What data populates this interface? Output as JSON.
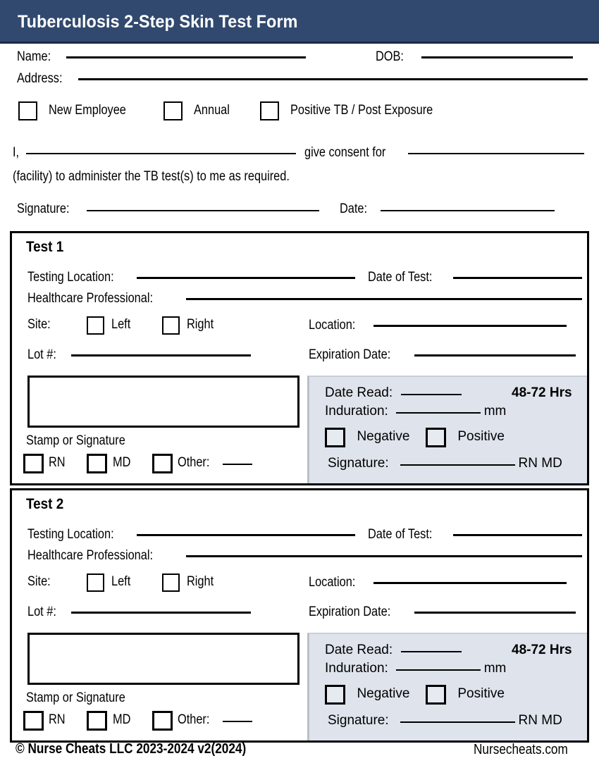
{
  "header": {
    "title": "Tuberculosis 2-Step Skin Test Form",
    "bar_color": "#31496e",
    "title_color": "#ffffff"
  },
  "identity": {
    "name_label": "Name:",
    "dob_label": "DOB:",
    "address_label": "Address:"
  },
  "visit_type": {
    "options": [
      {
        "label": "New Employee",
        "checked": false
      },
      {
        "label": "Annual",
        "checked": false
      },
      {
        "label": "Positive  TB / Post Exposure",
        "checked": false
      }
    ]
  },
  "consent": {
    "lead": "I,",
    "middle": "give consent for",
    "second_line": "(facility) to administer the TB test(s) to me as required.",
    "signature_label": "Signature:",
    "date_label": "Date:"
  },
  "tests": [
    {
      "title": "Test 1",
      "testing_location_label": "Testing Location:",
      "date_of_test_label": "Date of Test:",
      "healthcare_professional_label": "Healthcare Professional:",
      "site_label": "Site:",
      "site_options": [
        {
          "label": "Left",
          "checked": false
        },
        {
          "label": "Right",
          "checked": false
        }
      ],
      "location_label": "Location:",
      "lot_label": "Lot #:",
      "expiration_label": "Expiration Date:",
      "stamp_label": "Stamp or Signature",
      "credentials": [
        {
          "label": "RN",
          "checked": false
        },
        {
          "label": "MD",
          "checked": false
        },
        {
          "label": "Other:",
          "checked": false
        }
      ],
      "read_panel": {
        "date_read_label": "Date Read:",
        "hours_note": "48-72 Hrs",
        "induration_label": "Induration:",
        "induration_unit": "mm",
        "result_options": [
          {
            "label": "Negative",
            "checked": false
          },
          {
            "label": "Positive",
            "checked": false
          }
        ],
        "signature_label": "Signature:",
        "credentials_suffix": "RN MD",
        "background_color": "#dee3ec"
      }
    },
    {
      "title": "Test 2",
      "testing_location_label": "Testing Location:",
      "date_of_test_label": "Date of Test:",
      "healthcare_professional_label": "Healthcare Professional:",
      "site_label": "Site:",
      "site_options": [
        {
          "label": "Left",
          "checked": false
        },
        {
          "label": "Right",
          "checked": false
        }
      ],
      "location_label": "Location:",
      "lot_label": "Lot #:",
      "expiration_label": "Expiration Date:",
      "stamp_label": "Stamp or Signature",
      "credentials": [
        {
          "label": "RN",
          "checked": false
        },
        {
          "label": "MD",
          "checked": false
        },
        {
          "label": "Other:",
          "checked": false
        }
      ],
      "read_panel": {
        "date_read_label": "Date Read:",
        "hours_note": "48-72 Hrs",
        "induration_label": "Induration:",
        "induration_unit": "mm",
        "result_options": [
          {
            "label": "Negative",
            "checked": false
          },
          {
            "label": "Positive",
            "checked": false
          }
        ],
        "signature_label": "Signature:",
        "credentials_suffix": "RN MD",
        "background_color": "#dee3ec"
      }
    }
  ],
  "footer": {
    "copyright": "© Nurse Cheats LLC 2023-2024 v2(2024)",
    "website": "Nursecheats.com"
  }
}
